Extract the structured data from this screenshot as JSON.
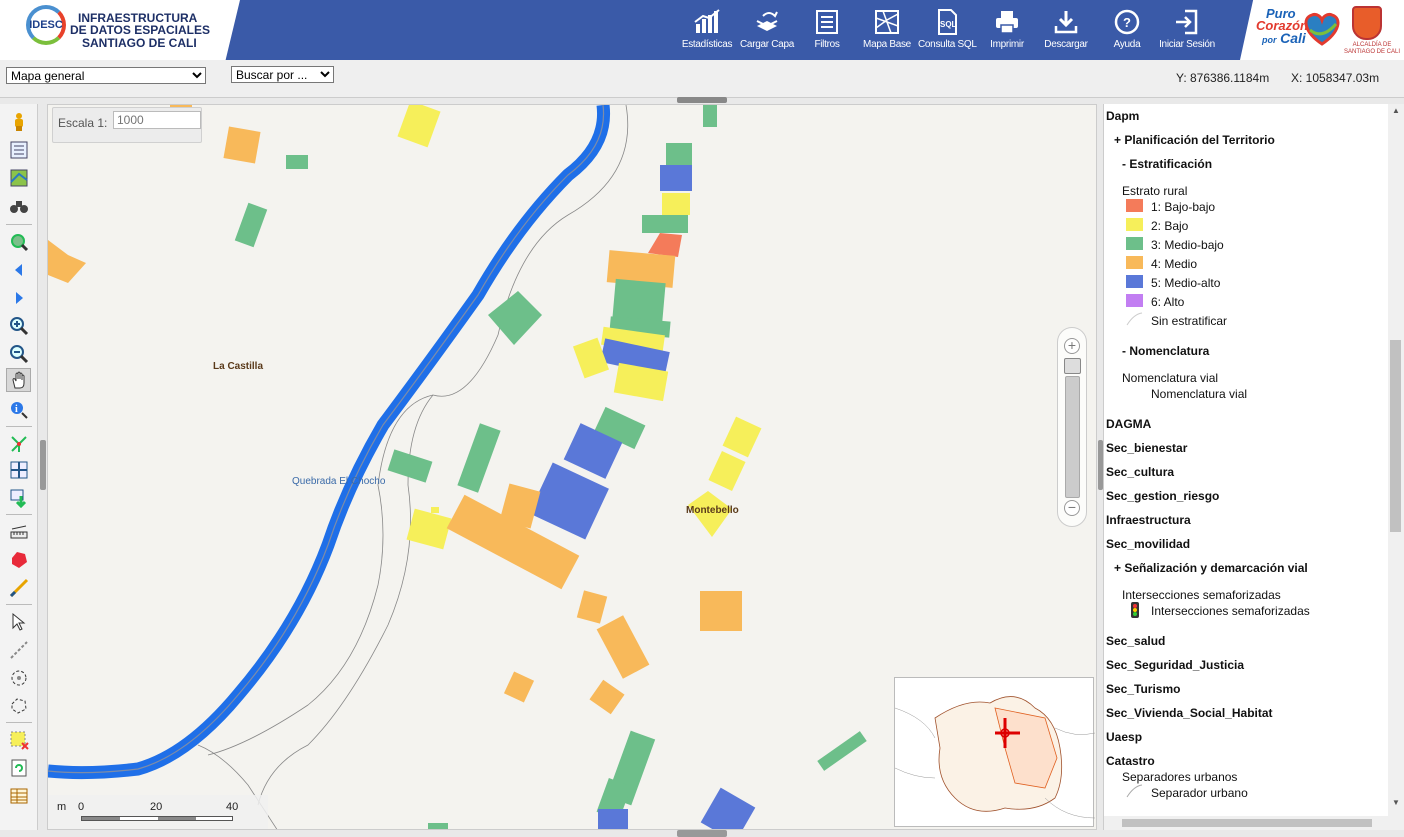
{
  "header": {
    "logo_badge": "IDESC",
    "logo_line1": "INFRAESTRUCTURA",
    "logo_line2": "DE DATOS ESPACIALES",
    "logo_line3": "SANTIAGO DE CALI",
    "slogan_line1": "Puro",
    "slogan_line2": "Corazón",
    "slogan_line3": "por",
    "slogan_line4": "Cali",
    "alcaldia_line1": "ALCALDÍA DE",
    "alcaldia_line2": "SANTIAGO DE CALI",
    "tools": [
      {
        "label": "Estadísticas",
        "icon": "bar-chart-icon"
      },
      {
        "label": "Cargar Capa",
        "icon": "upload-layer-icon"
      },
      {
        "label": "Filtros",
        "icon": "filter-icon"
      },
      {
        "label": "Mapa Base",
        "icon": "basemap-icon"
      },
      {
        "label": "Consulta SQL",
        "icon": "sql-icon"
      },
      {
        "label": "Imprimir",
        "icon": "printer-icon"
      },
      {
        "label": "Descargar",
        "icon": "download-icon"
      },
      {
        "label": "Ayuda",
        "icon": "help-icon"
      },
      {
        "label": "Iniciar Sesión",
        "icon": "login-icon"
      }
    ],
    "accent": "#3a5aa8"
  },
  "subbar": {
    "map_select": "Mapa general",
    "search_select": "Buscar por ...",
    "coord_y": "Y: 876386.1184m",
    "coord_x": "X: 1058347.03m"
  },
  "map": {
    "scale_label": "Escala 1:",
    "scale_placeholder": "1000",
    "places": [
      "La Castilla",
      "Montebello"
    ],
    "stream_label": "Quebrada El Chocho",
    "scalebar": {
      "unit": "m",
      "ticks": [
        "0",
        "20",
        "40"
      ]
    }
  },
  "legend": {
    "dapm": "Dapm",
    "planificacion": "+ Planificación del Territorio",
    "estratificacion": "- Estratificación",
    "estrato_title": "Estrato rural",
    "estratos": [
      {
        "label": "1: Bajo-bajo",
        "color": "#f47b5a"
      },
      {
        "label": "2: Bajo",
        "color": "#f6ef5a"
      },
      {
        "label": "3: Medio-bajo",
        "color": "#6dbf8a"
      },
      {
        "label": "4: Medio",
        "color": "#f8b95a"
      },
      {
        "label": "5: Medio-alto",
        "color": "#5a78d8"
      },
      {
        "label": "6: Alto",
        "color": "#c27ef2"
      }
    ],
    "sin_estratificar": "Sin estratificar",
    "nomenclatura": "- Nomenclatura",
    "nomenclatura_vial_title": "Nomenclatura vial",
    "nomenclatura_vial_item": "Nomenclatura vial",
    "groups": [
      "DAGMA",
      "Sec_bienestar",
      "Sec_cultura",
      "Sec_gestion_riesgo",
      "Infraestructura",
      "Sec_movilidad"
    ],
    "senalizacion": "+ Señalización y demarcación vial",
    "intersecciones_title": "Intersecciones semaforizadas",
    "intersecciones_item": "Intersecciones semaforizadas",
    "groups2": [
      "Sec_salud",
      "Sec_Seguridad_Justicia",
      "Sec_Turismo",
      "Sec_Vivienda_Social_Habitat",
      "Uaesp",
      "Catastro"
    ],
    "separadores_title": "Separadores urbanos",
    "separador_item": "Separador urbano"
  }
}
